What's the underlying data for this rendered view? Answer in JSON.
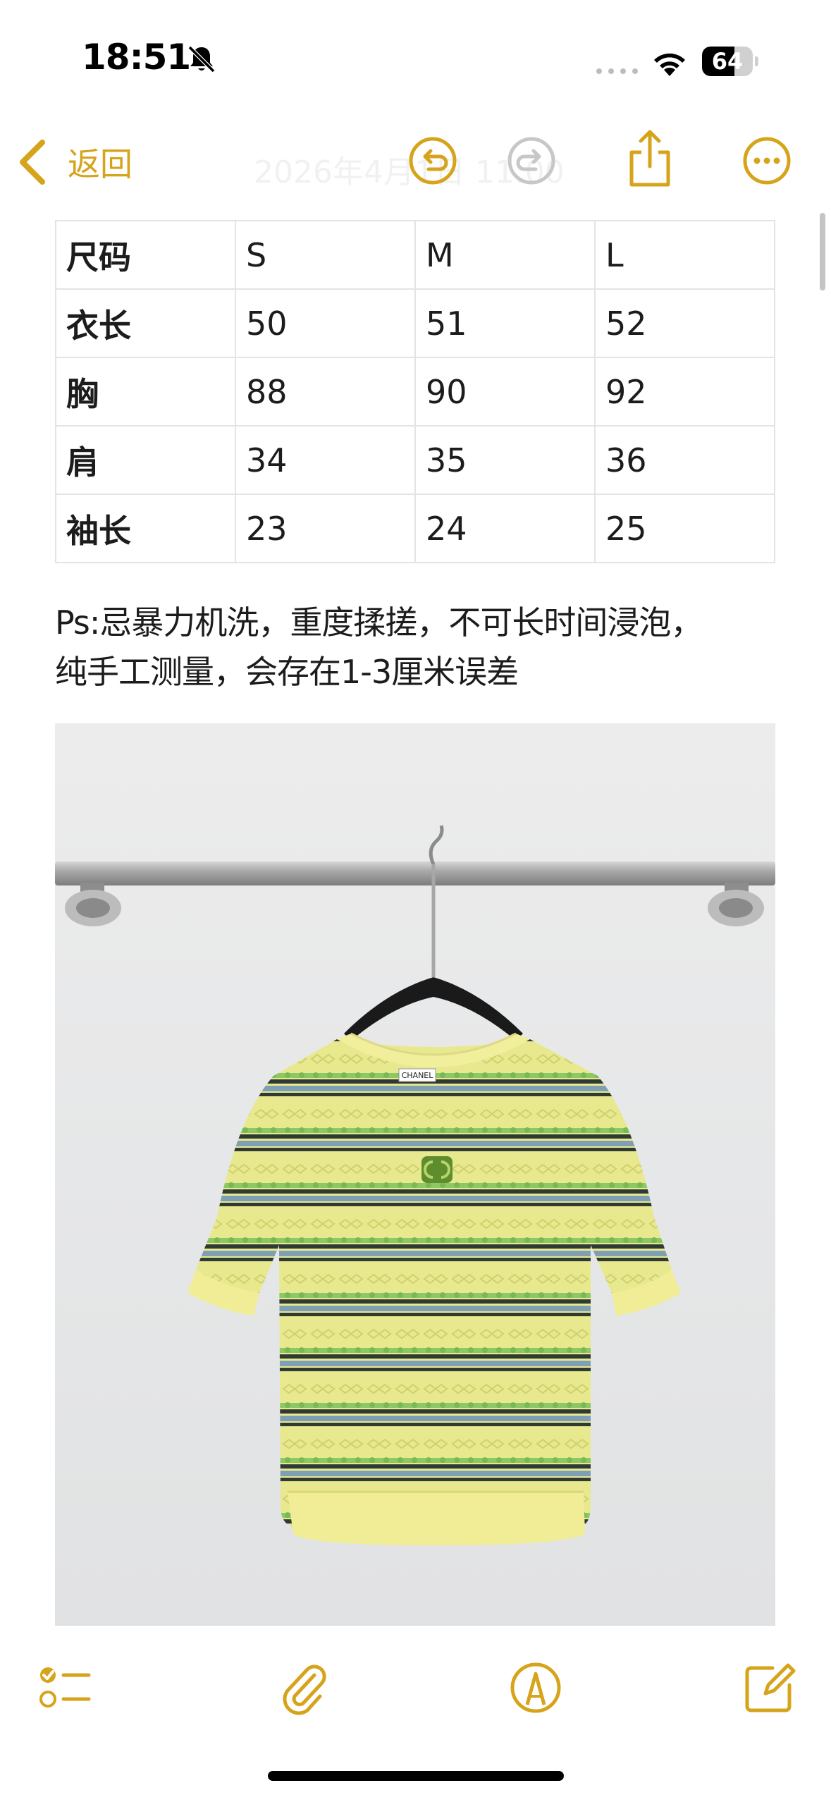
{
  "status_bar": {
    "time": "18:51",
    "battery_level": "64",
    "battery_fraction": 0.64
  },
  "nav": {
    "back_label": "返回",
    "date_title": "2026年4月1日 11:00",
    "icons": {
      "undo": "undo-icon",
      "redo": "redo-icon",
      "share": "share-icon",
      "more": "more-icon"
    }
  },
  "colors": {
    "accent": "#d6a41b",
    "text": "#1c1c1c",
    "table_border": "#e4e4e4",
    "disabled": "#c7c7c7"
  },
  "size_table": {
    "rows": [
      [
        "尺码",
        "S",
        "M",
        "L"
      ],
      [
        "衣长",
        "50",
        "51",
        "52"
      ],
      [
        "胸",
        "88",
        "90",
        "92"
      ],
      [
        "肩",
        "34",
        "35",
        "36"
      ],
      [
        "袖长",
        "23",
        "24",
        "25"
      ]
    ]
  },
  "note": {
    "text": "Ps:忌暴力机洗，重度揉搓，不可长时间浸泡，\n纯手工测量，会存在1-3厘米误差"
  },
  "photo": {
    "logo_text": "CHANEL"
  },
  "toolbar": {
    "icons": {
      "checklist": "checklist-icon",
      "attach": "paperclip-icon",
      "markup": "markup-pen-icon",
      "compose": "compose-icon"
    }
  }
}
